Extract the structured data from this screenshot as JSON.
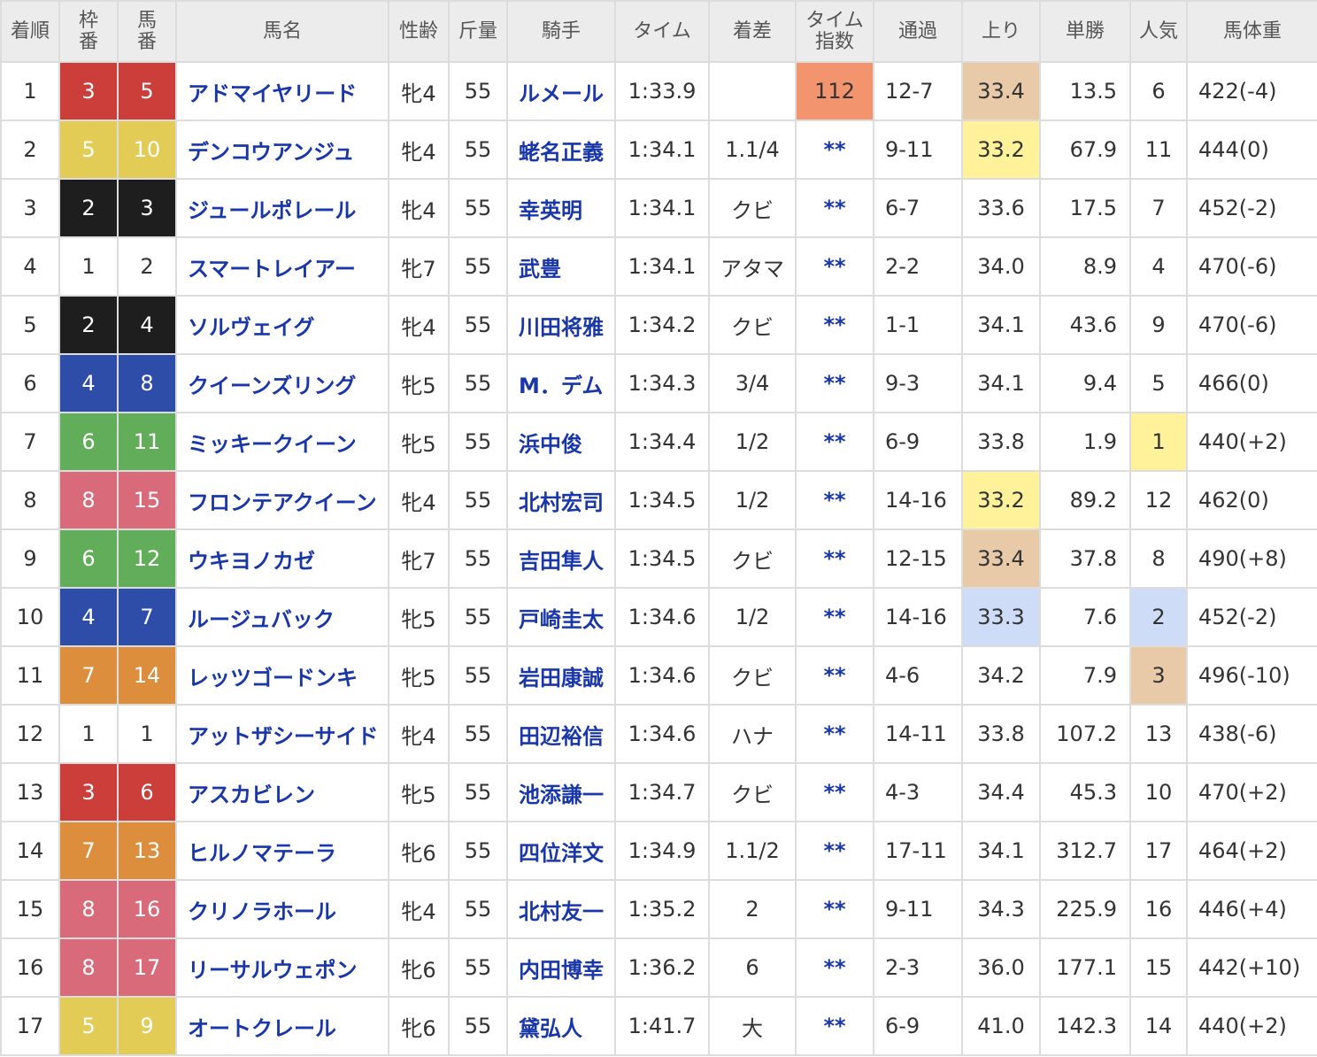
{
  "colors": {
    "link": "#1a37a8",
    "header_bg": "#ececec",
    "border": "#dcdcdc",
    "highlight_best": "#f2956f",
    "highlight_first": "#fff29a",
    "highlight_second": "#cfdcf8",
    "highlight_third": "#e8c9a8",
    "frames": {
      "1": {
        "bg": "#ffffff",
        "fg": "#333333"
      },
      "2": {
        "bg": "#1e1e1e",
        "fg": "#ffffff"
      },
      "3": {
        "bg": "#cc3e3a",
        "fg": "#ffffff"
      },
      "4": {
        "bg": "#2d4da8",
        "fg": "#ffffff"
      },
      "5": {
        "bg": "#e3cc56",
        "fg": "#ffffff"
      },
      "6": {
        "bg": "#62ad5a",
        "fg": "#ffffff"
      },
      "7": {
        "bg": "#dc8e3c",
        "fg": "#ffffff"
      },
      "8": {
        "bg": "#d86a7a",
        "fg": "#ffffff"
      }
    }
  },
  "headers": {
    "rank": "着順",
    "waku": [
      "枠",
      "番"
    ],
    "uma": [
      "馬",
      "番"
    ],
    "name": "馬名",
    "sexage": "性齢",
    "weight": "斤量",
    "jockey": "騎手",
    "time": "タイム",
    "margin": "着差",
    "index": [
      "タイム",
      "指数"
    ],
    "passing": "通過",
    "last": "上り",
    "odds": "単勝",
    "pop": "人気",
    "body": "馬体重"
  },
  "rows": [
    {
      "rank": "1",
      "waku": "3",
      "uma": "5",
      "name": "アドマイヤリード",
      "sexage": "牝4",
      "weight": "55",
      "jockey": "ルメール",
      "time": "1:33.9",
      "margin": "",
      "index": "112",
      "index_hl": "best",
      "passing": "12-7",
      "last": "33.4",
      "last_hl": "third",
      "odds": "13.5",
      "pop": "6",
      "pop_hl": "",
      "body": "422(-4)"
    },
    {
      "rank": "2",
      "waku": "5",
      "uma": "10",
      "name": "デンコウアンジュ",
      "sexage": "牝4",
      "weight": "55",
      "jockey": "蛯名正義",
      "time": "1:34.1",
      "margin": "1.1/4",
      "index": "**",
      "index_hl": "",
      "passing": "9-11",
      "last": "33.2",
      "last_hl": "first",
      "odds": "67.9",
      "pop": "11",
      "pop_hl": "",
      "body": "444(0)"
    },
    {
      "rank": "3",
      "waku": "2",
      "uma": "3",
      "name": "ジュールポレール",
      "sexage": "牝4",
      "weight": "55",
      "jockey": "幸英明",
      "time": "1:34.1",
      "margin": "クビ",
      "index": "**",
      "index_hl": "",
      "passing": "6-7",
      "last": "33.6",
      "last_hl": "",
      "odds": "17.5",
      "pop": "7",
      "pop_hl": "",
      "body": "452(-2)"
    },
    {
      "rank": "4",
      "waku": "1",
      "uma": "2",
      "name": "スマートレイアー",
      "sexage": "牝7",
      "weight": "55",
      "jockey": "武豊",
      "time": "1:34.1",
      "margin": "アタマ",
      "index": "**",
      "index_hl": "",
      "passing": "2-2",
      "last": "34.0",
      "last_hl": "",
      "odds": "8.9",
      "pop": "4",
      "pop_hl": "",
      "body": "470(-6)"
    },
    {
      "rank": "5",
      "waku": "2",
      "uma": "4",
      "name": "ソルヴェイグ",
      "sexage": "牝4",
      "weight": "55",
      "jockey": "川田将雅",
      "time": "1:34.2",
      "margin": "クビ",
      "index": "**",
      "index_hl": "",
      "passing": "1-1",
      "last": "34.1",
      "last_hl": "",
      "odds": "43.6",
      "pop": "9",
      "pop_hl": "",
      "body": "470(-6)"
    },
    {
      "rank": "6",
      "waku": "4",
      "uma": "8",
      "name": "クイーンズリング",
      "sexage": "牝5",
      "weight": "55",
      "jockey": "M．デム",
      "time": "1:34.3",
      "margin": "3/4",
      "index": "**",
      "index_hl": "",
      "passing": "9-3",
      "last": "34.1",
      "last_hl": "",
      "odds": "9.4",
      "pop": "5",
      "pop_hl": "",
      "body": "466(0)"
    },
    {
      "rank": "7",
      "waku": "6",
      "uma": "11",
      "name": "ミッキークイーン",
      "sexage": "牝5",
      "weight": "55",
      "jockey": "浜中俊",
      "time": "1:34.4",
      "margin": "1/2",
      "index": "**",
      "index_hl": "",
      "passing": "6-9",
      "last": "33.8",
      "last_hl": "",
      "odds": "1.9",
      "pop": "1",
      "pop_hl": "first",
      "body": "440(+2)"
    },
    {
      "rank": "8",
      "waku": "8",
      "uma": "15",
      "name": "フロンテアクイーン",
      "sexage": "牝4",
      "weight": "55",
      "jockey": "北村宏司",
      "time": "1:34.5",
      "margin": "1/2",
      "index": "**",
      "index_hl": "",
      "passing": "14-16",
      "last": "33.2",
      "last_hl": "first",
      "odds": "89.2",
      "pop": "12",
      "pop_hl": "",
      "body": "462(0)"
    },
    {
      "rank": "9",
      "waku": "6",
      "uma": "12",
      "name": "ウキヨノカゼ",
      "sexage": "牝7",
      "weight": "55",
      "jockey": "吉田隼人",
      "time": "1:34.5",
      "margin": "クビ",
      "index": "**",
      "index_hl": "",
      "passing": "12-15",
      "last": "33.4",
      "last_hl": "third",
      "odds": "37.8",
      "pop": "8",
      "pop_hl": "",
      "body": "490(+8)"
    },
    {
      "rank": "10",
      "waku": "4",
      "uma": "7",
      "name": "ルージュバック",
      "sexage": "牝5",
      "weight": "55",
      "jockey": "戸崎圭太",
      "time": "1:34.6",
      "margin": "1/2",
      "index": "**",
      "index_hl": "",
      "passing": "14-16",
      "last": "33.3",
      "last_hl": "second",
      "odds": "7.6",
      "pop": "2",
      "pop_hl": "second",
      "body": "452(-2)"
    },
    {
      "rank": "11",
      "waku": "7",
      "uma": "14",
      "name": "レッツゴードンキ",
      "sexage": "牝5",
      "weight": "55",
      "jockey": "岩田康誠",
      "time": "1:34.6",
      "margin": "クビ",
      "index": "**",
      "index_hl": "",
      "passing": "4-6",
      "last": "34.2",
      "last_hl": "",
      "odds": "7.9",
      "pop": "3",
      "pop_hl": "third",
      "body": "496(-10)"
    },
    {
      "rank": "12",
      "waku": "1",
      "uma": "1",
      "name": "アットザシーサイド",
      "sexage": "牝4",
      "weight": "55",
      "jockey": "田辺裕信",
      "time": "1:34.6",
      "margin": "ハナ",
      "index": "**",
      "index_hl": "",
      "passing": "14-11",
      "last": "33.8",
      "last_hl": "",
      "odds": "107.2",
      "pop": "13",
      "pop_hl": "",
      "body": "438(-6)"
    },
    {
      "rank": "13",
      "waku": "3",
      "uma": "6",
      "name": "アスカビレン",
      "sexage": "牝5",
      "weight": "55",
      "jockey": "池添謙一",
      "time": "1:34.7",
      "margin": "クビ",
      "index": "**",
      "index_hl": "",
      "passing": "4-3",
      "last": "34.4",
      "last_hl": "",
      "odds": "45.3",
      "pop": "10",
      "pop_hl": "",
      "body": "470(+2)"
    },
    {
      "rank": "14",
      "waku": "7",
      "uma": "13",
      "name": "ヒルノマテーラ",
      "sexage": "牝6",
      "weight": "55",
      "jockey": "四位洋文",
      "time": "1:34.9",
      "margin": "1.1/2",
      "index": "**",
      "index_hl": "",
      "passing": "17-11",
      "last": "34.1",
      "last_hl": "",
      "odds": "312.7",
      "pop": "17",
      "pop_hl": "",
      "body": "464(+2)"
    },
    {
      "rank": "15",
      "waku": "8",
      "uma": "16",
      "name": "クリノラホール",
      "sexage": "牝4",
      "weight": "55",
      "jockey": "北村友一",
      "time": "1:35.2",
      "margin": "2",
      "index": "**",
      "index_hl": "",
      "passing": "9-11",
      "last": "34.3",
      "last_hl": "",
      "odds": "225.9",
      "pop": "16",
      "pop_hl": "",
      "body": "446(+4)"
    },
    {
      "rank": "16",
      "waku": "8",
      "uma": "17",
      "name": "リーサルウェポン",
      "sexage": "牝6",
      "weight": "55",
      "jockey": "内田博幸",
      "time": "1:36.2",
      "margin": "6",
      "index": "**",
      "index_hl": "",
      "passing": "2-3",
      "last": "36.0",
      "last_hl": "",
      "odds": "177.1",
      "pop": "15",
      "pop_hl": "",
      "body": "442(+10)"
    },
    {
      "rank": "17",
      "waku": "5",
      "uma": "9",
      "name": "オートクレール",
      "sexage": "牝6",
      "weight": "55",
      "jockey": "黛弘人",
      "time": "1:41.7",
      "margin": "大",
      "index": "**",
      "index_hl": "",
      "passing": "6-9",
      "last": "41.0",
      "last_hl": "",
      "odds": "142.3",
      "pop": "14",
      "pop_hl": "",
      "body": "440(+2)"
    }
  ]
}
